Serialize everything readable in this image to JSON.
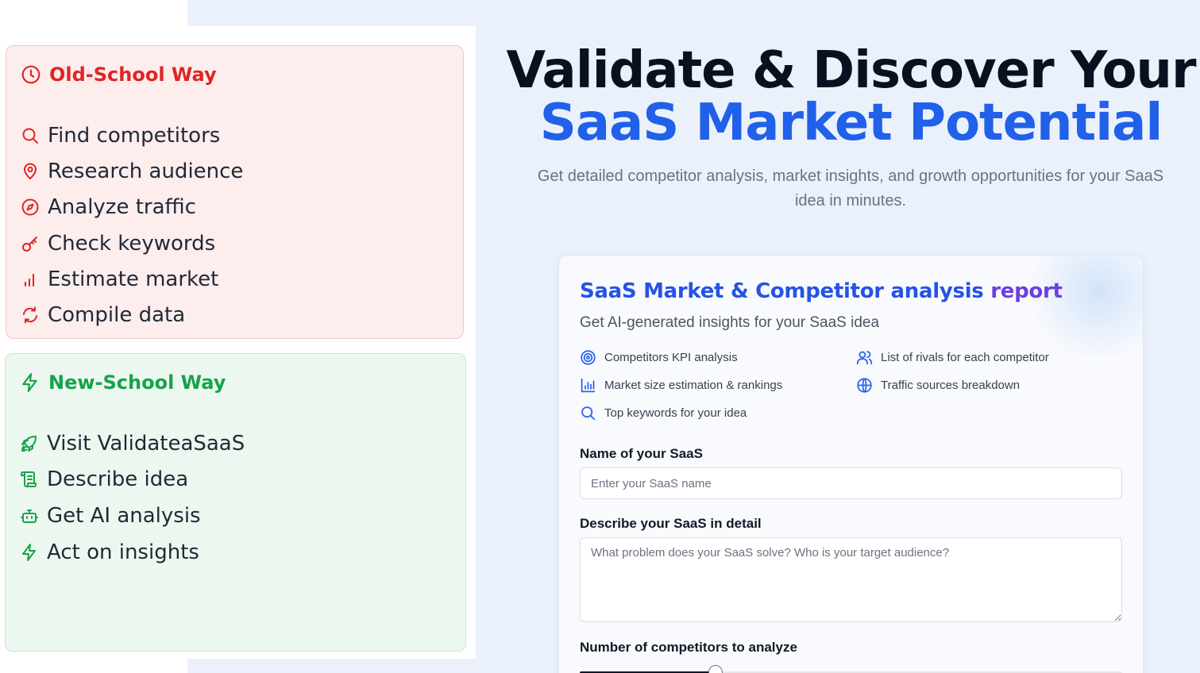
{
  "old_school": {
    "title": "Old-School Way",
    "title_icon": "clock-icon",
    "color": "#e02424",
    "steps": [
      {
        "label": "Find competitors",
        "icon": "search-icon"
      },
      {
        "label": "Research audience",
        "icon": "map-pin-icon"
      },
      {
        "label": "Analyze traffic",
        "icon": "compass-icon"
      },
      {
        "label": "Check keywords",
        "icon": "key-icon"
      },
      {
        "label": "Estimate market",
        "icon": "bar-chart-icon"
      },
      {
        "label": "Compile data",
        "icon": "refresh-icon"
      }
    ]
  },
  "new_school": {
    "title": "New-School Way",
    "title_icon": "lightning-icon",
    "color": "#16a34a",
    "steps": [
      {
        "label": "Visit ValidateaSaaS",
        "icon": "rocket-icon"
      },
      {
        "label": "Describe idea",
        "icon": "scroll-icon"
      },
      {
        "label": "Get AI analysis",
        "icon": "robot-icon"
      },
      {
        "label": "Act on insights",
        "icon": "lightning-icon"
      }
    ]
  },
  "hero": {
    "title_line1": "Validate & Discover Your",
    "title_line2": "SaaS Market Potential",
    "subtitle": "Get detailed competitor analysis, market insights, and growth opportunities for your SaaS idea in minutes."
  },
  "form": {
    "title_main": "SaaS Market & Competitor analysis",
    "title_end": "report",
    "subtitle": "Get AI-generated insights for your SaaS idea",
    "features": [
      {
        "label": "Competitors KPI analysis",
        "icon": "target-icon"
      },
      {
        "label": "List of rivals for each competitor",
        "icon": "users-icon"
      },
      {
        "label": "Market size estimation & rankings",
        "icon": "bar-chart-icon"
      },
      {
        "label": "Traffic sources breakdown",
        "icon": "globe-icon"
      },
      {
        "label": "Top keywords for your idea",
        "icon": "search-icon"
      }
    ],
    "name_label": "Name of your SaaS",
    "name_value": "",
    "name_placeholder": "Enter your SaaS name",
    "desc_label": "Describe your SaaS in detail",
    "desc_value": "",
    "desc_placeholder": "What problem does your SaaS solve? Who is your target audience?",
    "competitors_label": "Number of competitors to analyze",
    "competitors_slider_fraction": 0.25
  },
  "colors": {
    "accent_blue": "#2160e8",
    "accent_purple": "#6d3ee0",
    "old_bg": "#fdeded",
    "new_bg": "#ecf8ef",
    "page_bg": "#eaf1fb"
  }
}
